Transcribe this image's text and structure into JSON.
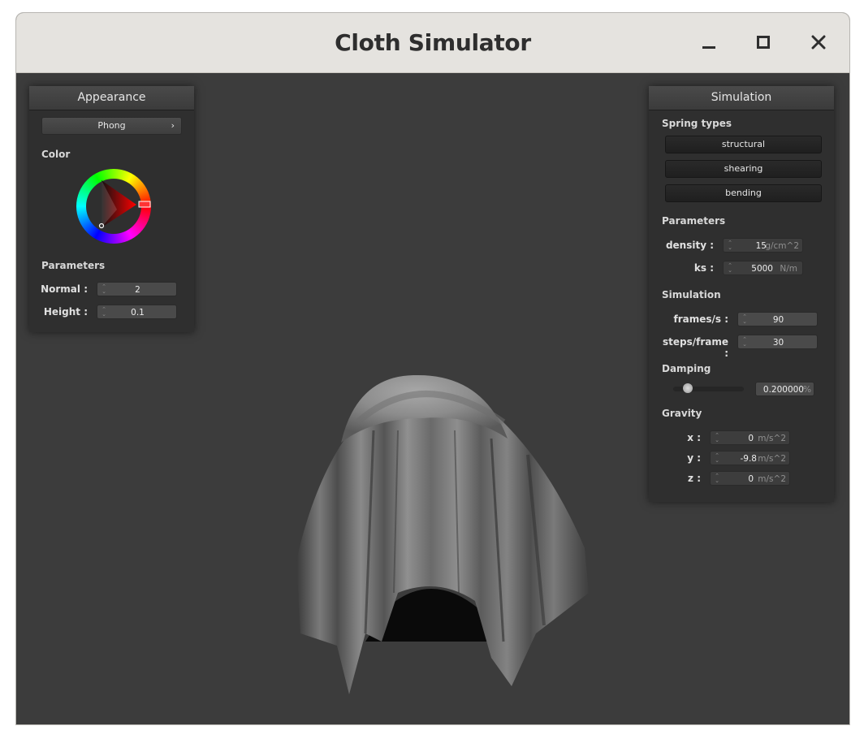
{
  "window": {
    "title": "Cloth Simulator",
    "controls": {
      "minimize": "minimize-icon",
      "maximize": "maximize-icon",
      "close": "close-icon"
    }
  },
  "appearance": {
    "header": "Appearance",
    "shader_select": {
      "value": "Phong",
      "chevron": "›"
    },
    "color_label": "Color",
    "color_wheel": {
      "icon": "color-wheel",
      "selected_hue": "#ff0000"
    },
    "parameters_label": "Parameters",
    "normal": {
      "label": "Normal :",
      "value": "2"
    },
    "height": {
      "label": "Height :",
      "value": "0.1"
    }
  },
  "simulation": {
    "header": "Simulation",
    "spring_types_label": "Spring types",
    "spring_buttons": [
      "structural",
      "shearing",
      "bending"
    ],
    "parameters_label": "Parameters",
    "density": {
      "label": "density :",
      "value": "15",
      "unit": "g/cm^2"
    },
    "ks": {
      "label": "ks :",
      "value": "5000",
      "unit": "N/m"
    },
    "simulation_label": "Simulation",
    "fps": {
      "label": "frames/s :",
      "value": "90"
    },
    "steps": {
      "label": "steps/frame :",
      "value": "30"
    },
    "damping_label": "Damping",
    "damping": {
      "value": "0.200000",
      "unit": "%",
      "slider_fraction": 0.2
    },
    "gravity_label": "Gravity",
    "gx": {
      "label": "x :",
      "value": "0",
      "unit": "m/s^2"
    },
    "gy": {
      "label": "y :",
      "value": "-9.8",
      "unit": "m/s^2"
    },
    "gz": {
      "label": "z :",
      "value": "0",
      "unit": "m/s^2"
    }
  },
  "colors": {
    "titlebar": "#e5e3df",
    "viewport": "#3c3c3c",
    "panel": "#2f2f2f",
    "cloth": "#8a8a8a"
  }
}
